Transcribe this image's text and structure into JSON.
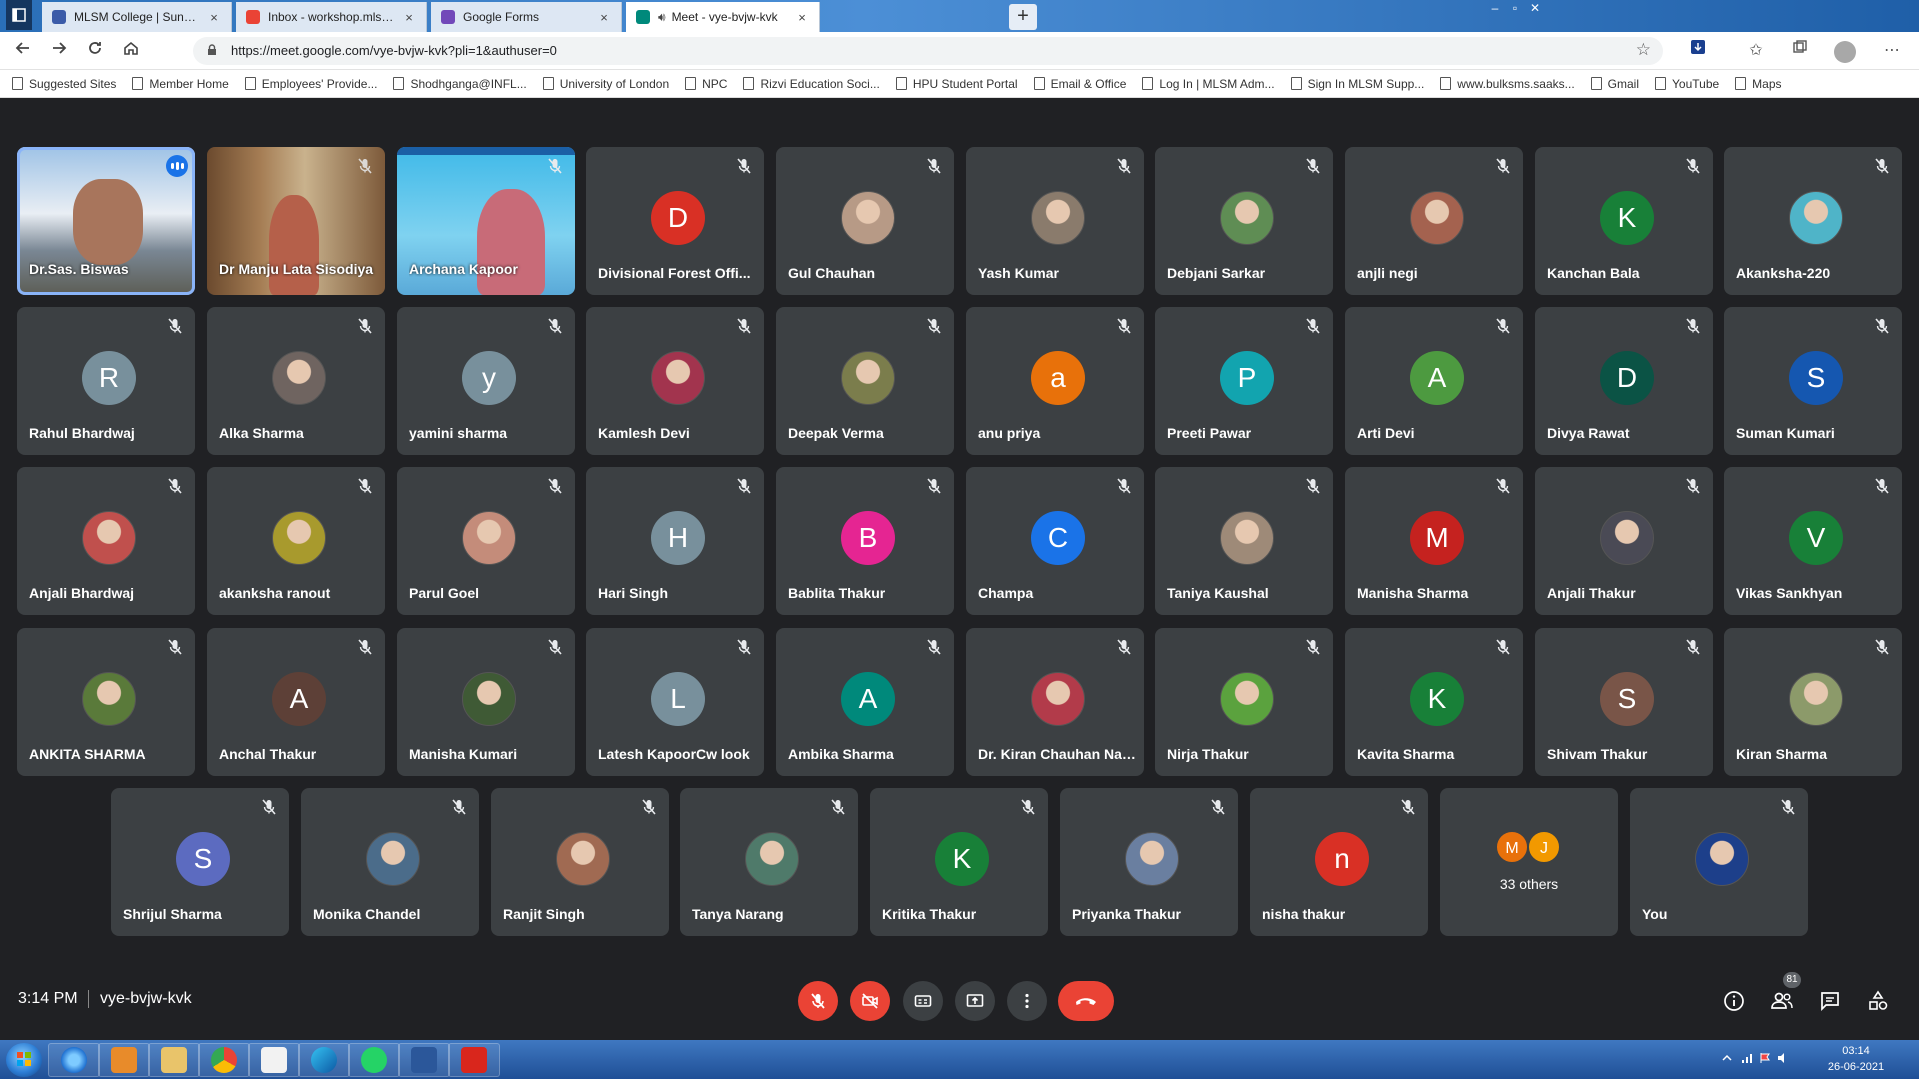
{
  "browser": {
    "tabs": [
      {
        "title": "MLSM College | Sundernagar, M",
        "fav_color": "#3b5ba8",
        "active": false
      },
      {
        "title": "Inbox - workshop.mlsm@gmail.c",
        "fav_color": "#ea4335",
        "active": false
      },
      {
        "title": "Google Forms",
        "fav_color": "#7248b9",
        "active": false
      },
      {
        "title": "Meet - vye-bvjw-kvk",
        "fav_color": "#00897b",
        "active": true
      }
    ],
    "new_tab_symbol": "+",
    "close_symbol": "×",
    "window_controls": [
      "–",
      "▫",
      "✕"
    ],
    "url": "https://meet.google.com/vye-bvjw-kvk?pli=1&authuser=0",
    "bookmarks": [
      "Suggested Sites",
      "Member Home",
      "Employees' Provide...",
      "Shodhganga@INFL...",
      "University of London",
      "NPC",
      "Rizvi Education Soci...",
      "HPU Student Portal",
      "Email & Office",
      "Log In | MLSM Adm...",
      "Sign In MLSM Supp...",
      "www.bulksms.saaks...",
      "Gmail",
      "YouTube",
      "Maps"
    ]
  },
  "meet": {
    "participants": [
      {
        "name": "Dr.Sas. Biswas",
        "kind": "video",
        "speaking": true
      },
      {
        "name": "Dr Manju Lata Sisodiya",
        "kind": "video"
      },
      {
        "name": "Archana Kapoor",
        "kind": "video"
      },
      {
        "name": "Divisional Forest Offi...",
        "initial": "D",
        "color": "#d93025"
      },
      {
        "name": "Gul Chauhan",
        "photo": "#b79a86"
      },
      {
        "name": "Yash Kumar",
        "photo": "#8a7b6c"
      },
      {
        "name": "Debjani Sarkar",
        "photo": "#5f8d54"
      },
      {
        "name": "anjli negi",
        "photo": "#a4624f"
      },
      {
        "name": "Kanchan Bala",
        "initial": "K",
        "color": "#188038"
      },
      {
        "name": "Akanksha-220",
        "photo": "#4fb4c8"
      },
      {
        "name": "Rahul Bhardwaj",
        "initial": "R",
        "color": "#78909c"
      },
      {
        "name": "Alka Sharma",
        "photo": "#6f6460"
      },
      {
        "name": "yamini sharma",
        "initial": "y",
        "color": "#78909c"
      },
      {
        "name": "Kamlesh Devi",
        "photo": "#a2344e"
      },
      {
        "name": "Deepak Verma",
        "photo": "#7b7d4c"
      },
      {
        "name": "anu priya",
        "initial": "a",
        "color": "#e8710a"
      },
      {
        "name": "Preeti Pawar",
        "initial": "P",
        "color": "#12a4af"
      },
      {
        "name": "Arti Devi",
        "initial": "A",
        "color": "#4d9a40"
      },
      {
        "name": "Divya Rawat",
        "initial": "D",
        "color": "#0b5345"
      },
      {
        "name": "Suman Kumari",
        "initial": "S",
        "color": "#1557b0"
      },
      {
        "name": "Anjali Bhardwaj",
        "photo": "#c0504d"
      },
      {
        "name": "akanksha ranout",
        "photo": "#a89a2d"
      },
      {
        "name": "Parul Goel",
        "photo": "#c48c7a"
      },
      {
        "name": "Hari Singh",
        "initial": "H",
        "color": "#78909c"
      },
      {
        "name": "Bablita Thakur",
        "initial": "B",
        "color": "#e52592"
      },
      {
        "name": "Champa",
        "initial": "C",
        "color": "#1a73e8"
      },
      {
        "name": "Taniya Kaushal",
        "photo": "#9e8a78"
      },
      {
        "name": "Manisha Sharma",
        "initial": "M",
        "color": "#c5221f"
      },
      {
        "name": "Anjali Thakur",
        "photo": "#4a4a55"
      },
      {
        "name": "Vikas Sankhyan",
        "initial": "V",
        "color": "#188038"
      },
      {
        "name": "ANKITA SHARMA",
        "photo": "#5a7a3a"
      },
      {
        "name": "Anchal Thakur",
        "initial": "A",
        "color": "#5d4037"
      },
      {
        "name": "Manisha Kumari",
        "photo": "#3f5a35"
      },
      {
        "name": "Latesh KapoorCw look",
        "initial": "L",
        "color": "#78909c"
      },
      {
        "name": "Ambika Sharma",
        "initial": "A",
        "color": "#00897b"
      },
      {
        "name": "Dr. Kiran Chauhan Nar...",
        "photo": "#b23b4a"
      },
      {
        "name": "Nirja Thakur",
        "photo": "#5ba23e"
      },
      {
        "name": "Kavita Sharma",
        "initial": "K",
        "color": "#188038"
      },
      {
        "name": "Shivam Thakur",
        "initial": "S",
        "color": "#795548"
      },
      {
        "name": "Kiran Sharma",
        "photo": "#8c9a6a"
      },
      {
        "name": "Shrijul Sharma",
        "initial": "S",
        "color": "#5c6bc0"
      },
      {
        "name": "Monika Chandel",
        "photo": "#4b6c8a"
      },
      {
        "name": "Ranjit Singh",
        "photo": "#a06a52"
      },
      {
        "name": "Tanya Narang",
        "photo": "#4f7a6a"
      },
      {
        "name": "Kritika Thakur",
        "initial": "K",
        "color": "#188038"
      },
      {
        "name": "Priyanka Thakur",
        "photo": "#6a7fa0"
      },
      {
        "name": "nisha thakur",
        "initial": "n",
        "color": "#d93025"
      },
      {
        "name": "33 others",
        "kind": "others",
        "minis": [
          {
            "initial": "M",
            "color": "#e8710a"
          },
          {
            "initial": "J",
            "color": "#f29900"
          }
        ]
      },
      {
        "name": "You",
        "photo": "#1d3f8a"
      }
    ],
    "time": "3:14 PM",
    "meeting_code": "vye-bvjw-kvk",
    "people_count": "81"
  },
  "taskbar": {
    "time": "03:14",
    "date": "26-06-2021"
  }
}
